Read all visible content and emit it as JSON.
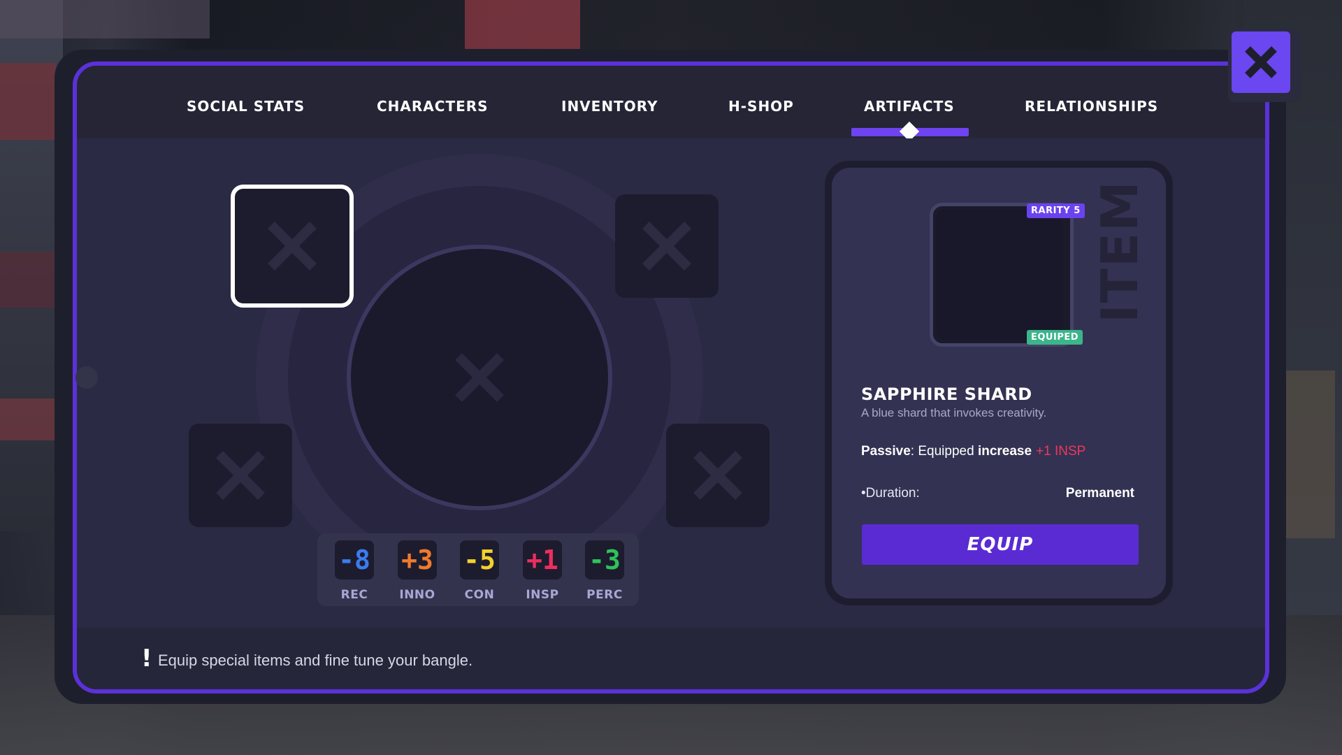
{
  "tabs": [
    {
      "label": "SOCIAL STATS"
    },
    {
      "label": "CHARACTERS"
    },
    {
      "label": "INVENTORY"
    },
    {
      "label": "H-SHOP"
    },
    {
      "label": "ARTIFACTS"
    },
    {
      "label": "RELATIONSHIPS"
    }
  ],
  "active_tab": "ARTIFACTS",
  "close_label": "X",
  "stats": [
    {
      "value": "-8",
      "label": "REC",
      "color": "#3a7cf0"
    },
    {
      "value": "+3",
      "label": "INNO",
      "color": "#f07a2c"
    },
    {
      "value": "-5",
      "label": "CON",
      "color": "#f2d12a"
    },
    {
      "value": "+1",
      "label": "INSP",
      "color": "#ec2e5e"
    },
    {
      "value": "-3",
      "label": "PERC",
      "color": "#2ec35a"
    }
  ],
  "item": {
    "side_label": "ITEM",
    "rarity": "RARITY 5",
    "status": "EQUIPED",
    "name": "SAPPHIRE SHARD",
    "description": "A blue shard that invokes creativity.",
    "passive_label": "Passive",
    "passive_text_1": ": Equipped ",
    "passive_text_2": "increase",
    "passive_bonus": "+1 INSP",
    "duration_label": "•Duration:",
    "duration_value": "Permanent",
    "equip_label": "EQUIP"
  },
  "footer": {
    "bang": "!",
    "hint": "Equip special items and fine tune your bangle."
  },
  "colors": {
    "accent": "#5b31d9",
    "bonus": "#f0375f",
    "equipped_badge": "#3bb58a",
    "rarity_badge": "#6a43ef"
  },
  "icons": {
    "empty_slot": "x-icon",
    "close": "close-icon"
  }
}
